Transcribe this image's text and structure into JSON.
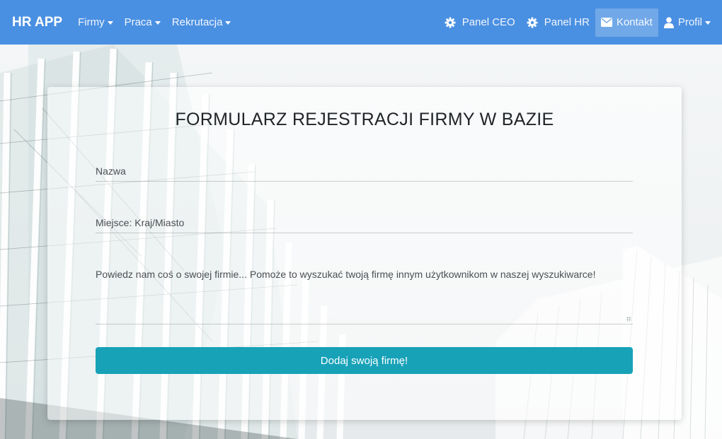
{
  "navbar": {
    "brand": "HR APP",
    "menus": [
      {
        "label": "Firmy"
      },
      {
        "label": "Praca"
      },
      {
        "label": "Rekrutacja"
      }
    ],
    "right": {
      "panel_ceo": "Panel CEO",
      "panel_hr": "Panel HR",
      "kontakt": "Kontakt",
      "profil": "Profil"
    },
    "color": "#4a90e2"
  },
  "form": {
    "title": "FORMULARZ REJESTRACJI FIRMY W BAZIE",
    "name_placeholder": "Nazwa",
    "location_placeholder": "Miejsce: Kraj/Miasto",
    "description_placeholder": "Powiedz nam coś o swojej firmie... Pomoże to wyszukać twoją firmę innym użytkownikom w naszej wyszukiwarce!",
    "submit_label": "Dodaj swoją firmę!",
    "submit_color": "#17a2b8"
  },
  "icons": {
    "panel_ceo": "gear-icon",
    "panel_hr": "gear-icon",
    "kontakt": "envelope-icon",
    "profil": "user-icon"
  }
}
